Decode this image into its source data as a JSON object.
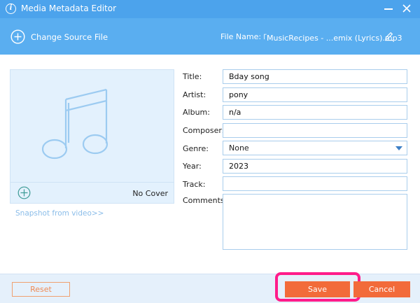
{
  "window": {
    "title": "Media Metadata Editor",
    "icons": {
      "info": "info-icon",
      "minimize": "minimize-icon",
      "close": "close-icon"
    }
  },
  "toolbar": {
    "change_source_label": "Change Source File",
    "file_name_label": "File Name:",
    "file_name_value": "「MusicRecipes -   ...emix (Lyrics).mp3"
  },
  "cover": {
    "no_cover_label": "No Cover",
    "snapshot_link": "Snapshot from video>>"
  },
  "fields": {
    "title": {
      "label": "Title:",
      "value": "Bday song"
    },
    "artist": {
      "label": "Artist:",
      "value": "pony"
    },
    "album": {
      "label": "Album:",
      "value": "n/a"
    },
    "composer": {
      "label": "Composer:",
      "value": ""
    },
    "genre": {
      "label": "Genre:",
      "value": "None"
    },
    "year": {
      "label": "Year:",
      "value": "2023"
    },
    "track": {
      "label": "Track:",
      "value": ""
    },
    "comments": {
      "label": "Comments:",
      "value": ""
    }
  },
  "footer": {
    "reset_label": "Reset",
    "save_label": "Save",
    "cancel_label": "Cancel"
  },
  "colors": {
    "titlebar": "#4ca3ec",
    "toolbar": "#5aaef0",
    "accent_orange": "#f26b3a",
    "highlight": "#ff1c8a"
  }
}
